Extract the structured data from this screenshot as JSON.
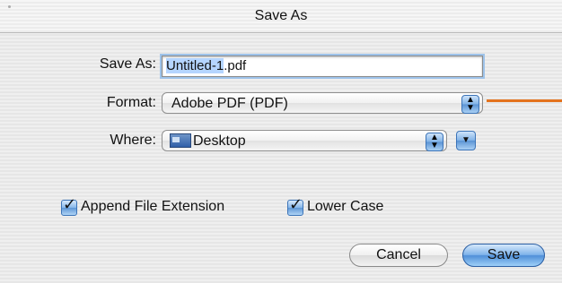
{
  "window": {
    "title": "Save As"
  },
  "save_as": {
    "label": "Save As:",
    "value_selected": "Untitled-1",
    "value_rest": ".pdf"
  },
  "format": {
    "label": "Format:",
    "selected": "Adobe PDF (PDF)"
  },
  "where": {
    "label": "Where:",
    "selected": "Desktop"
  },
  "options": {
    "append_extension": {
      "label": "Append File Extension",
      "checked": true
    },
    "lower_case": {
      "label": "Lower Case",
      "checked": true
    }
  },
  "buttons": {
    "cancel": "Cancel",
    "save": "Save"
  },
  "icons": {
    "stepper": "up-down-arrows-icon",
    "disclosure": "disclosure-triangle-icon",
    "folder": "desktop-folder-icon",
    "check": "checkmark-icon"
  },
  "colors": {
    "accent_blue": "#5a93d4",
    "annotation_line": "#e4731e",
    "selection": "#b5d5ff"
  }
}
